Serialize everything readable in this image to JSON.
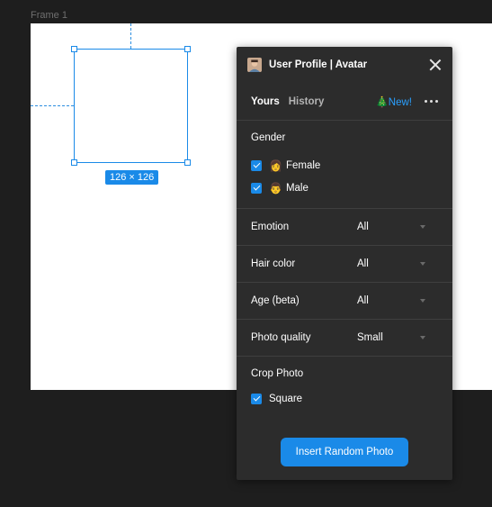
{
  "canvas": {
    "frame_label": "Frame 1",
    "selection_size": "126 × 126"
  },
  "panel": {
    "title": "User Profile | Avatar",
    "tabs": [
      {
        "label": "Yours",
        "active": true
      },
      {
        "label": "History",
        "active": false
      }
    ],
    "new_label": "New!",
    "new_emoji": "🎄",
    "gender": {
      "title": "Gender",
      "options": [
        {
          "emoji": "👩",
          "label": "Female",
          "checked": true
        },
        {
          "emoji": "👨",
          "label": "Male",
          "checked": true
        }
      ]
    },
    "filters": [
      {
        "label": "Emotion",
        "value": "All"
      },
      {
        "label": "Hair color",
        "value": "All"
      },
      {
        "label": "Age (beta)",
        "value": "All"
      },
      {
        "label": "Photo quality",
        "value": "Small"
      }
    ],
    "crop": {
      "title": "Crop Photo",
      "option_label": "Square",
      "checked": true
    },
    "insert_button": "Insert Random Photo"
  },
  "colors": {
    "accent": "#1a8ae8",
    "link": "#2aa0ff",
    "panel_bg": "#2c2c2c",
    "canvas_bg": "#1e1e1e"
  }
}
